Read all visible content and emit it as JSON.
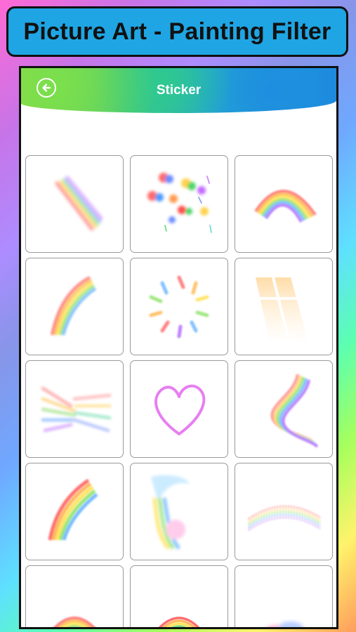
{
  "banner": {
    "title": "Picture Art - Painting Filter"
  },
  "appbar": {
    "title": "Sticker",
    "back_icon": "back-arrow-icon"
  },
  "stickers": [
    {
      "name": "sticker-rainbow-streak"
    },
    {
      "name": "sticker-rainbow-dots"
    },
    {
      "name": "sticker-rainbow-arc"
    },
    {
      "name": "sticker-rainbow-curve"
    },
    {
      "name": "sticker-rainbow-swirl"
    },
    {
      "name": "sticker-window-light"
    },
    {
      "name": "sticker-rainbow-rays"
    },
    {
      "name": "sticker-heart"
    },
    {
      "name": "sticker-rainbow-wave"
    },
    {
      "name": "sticker-rainbow-bend"
    },
    {
      "name": "sticker-rainbow-splash"
    },
    {
      "name": "sticker-sparkle-arc"
    },
    {
      "name": "sticker-rainbow-small-arc"
    },
    {
      "name": "sticker-glitter-arc"
    },
    {
      "name": "sticker-rainbow-glow"
    }
  ]
}
